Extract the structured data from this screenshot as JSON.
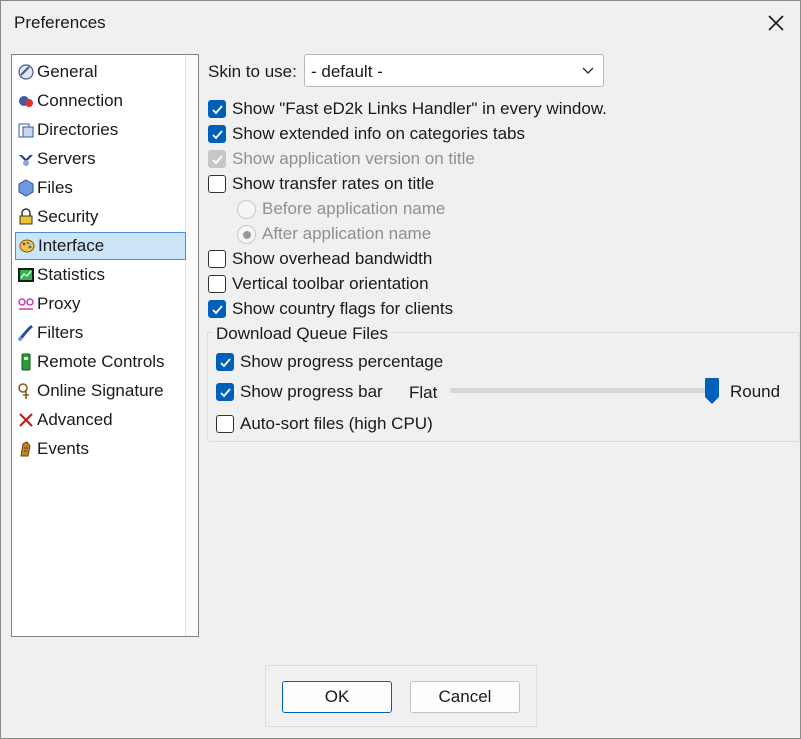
{
  "window": {
    "title": "Preferences"
  },
  "sidebar": {
    "items": [
      {
        "label": "General",
        "icon": "general-icon"
      },
      {
        "label": "Connection",
        "icon": "connection-icon"
      },
      {
        "label": "Directories",
        "icon": "directories-icon"
      },
      {
        "label": "Servers",
        "icon": "servers-icon"
      },
      {
        "label": "Files",
        "icon": "files-icon"
      },
      {
        "label": "Security",
        "icon": "lock-icon"
      },
      {
        "label": "Interface",
        "icon": "interface-icon",
        "selected": true
      },
      {
        "label": "Statistics",
        "icon": "statistics-icon"
      },
      {
        "label": "Proxy",
        "icon": "proxy-icon"
      },
      {
        "label": "Filters",
        "icon": "filters-icon"
      },
      {
        "label": "Remote Controls",
        "icon": "remote-controls-icon"
      },
      {
        "label": "Online Signature",
        "icon": "online-signature-icon"
      },
      {
        "label": "Advanced",
        "icon": "advanced-icon"
      },
      {
        "label": "Events",
        "icon": "events-icon"
      }
    ]
  },
  "interface": {
    "skin_label": "Skin to use:",
    "skin_value": "- default -",
    "options": {
      "fast_links": {
        "label": "Show \"Fast eD2k Links Handler\" in every window.",
        "checked": true
      },
      "extended_info": {
        "label": "Show extended info on categories tabs",
        "checked": true
      },
      "app_version": {
        "label": "Show application version on title",
        "checked": true,
        "disabled": true
      },
      "transfer_rates": {
        "label": "Show transfer rates on title",
        "checked": false
      },
      "before_name": {
        "label": "Before application name",
        "selected": false,
        "disabled": true
      },
      "after_name": {
        "label": "After application name",
        "selected": true,
        "disabled": true
      },
      "overhead": {
        "label": "Show overhead bandwidth",
        "checked": false
      },
      "vertical_toolbar": {
        "label": "Vertical toolbar orientation",
        "checked": false
      },
      "country_flags": {
        "label": "Show country flags for clients",
        "checked": true
      }
    },
    "download_queue": {
      "title": "Download Queue Files",
      "progress_percentage": {
        "label": "Show progress percentage",
        "checked": true
      },
      "progress_bar": {
        "label": "Show progress bar",
        "checked": true
      },
      "slider_min_label": "Flat",
      "slider_max_label": "Round",
      "slider_value": 1.0,
      "auto_sort": {
        "label": "Auto-sort files (high CPU)",
        "checked": false
      }
    }
  },
  "footer": {
    "ok_label": "OK",
    "cancel_label": "Cancel"
  },
  "colors": {
    "accent": "#005fb8",
    "selection": "#cce4f7"
  }
}
